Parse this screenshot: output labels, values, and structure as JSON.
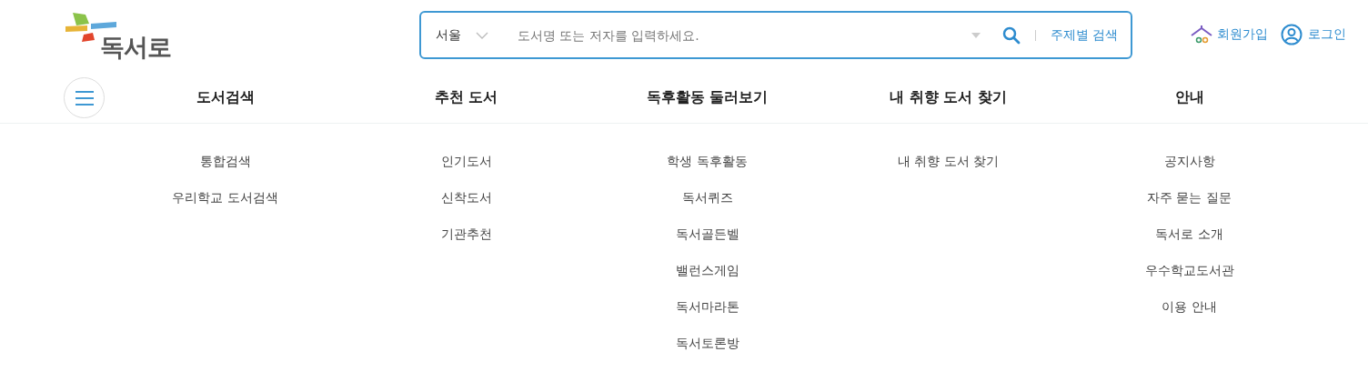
{
  "logo": {
    "text": "독서로"
  },
  "search": {
    "region": "서울",
    "placeholder": "도서명 또는 저자를 입력하세요.",
    "subject_link": "주제별 검색"
  },
  "account": {
    "signup": "회원가입",
    "login": "로그인"
  },
  "menu": [
    {
      "title": "도서검색",
      "items": [
        "통합검색",
        "우리학교 도서검색"
      ]
    },
    {
      "title": "추천 도서",
      "items": [
        "인기도서",
        "신착도서",
        "기관추천"
      ]
    },
    {
      "title": "독후활동 둘러보기",
      "items": [
        "학생 독후활동",
        "독서퀴즈",
        "독서골든벨",
        "밸런스게임",
        "독서마라톤",
        "독서토론방"
      ]
    },
    {
      "title": "내 취향 도서 찾기",
      "items": [
        "내 취향 도서 찾기"
      ]
    },
    {
      "title": "안내",
      "items": [
        "공지사항",
        "자주 묻는 질문",
        "독서로 소개",
        "우수학교도서관",
        "이용 안내"
      ]
    }
  ]
}
